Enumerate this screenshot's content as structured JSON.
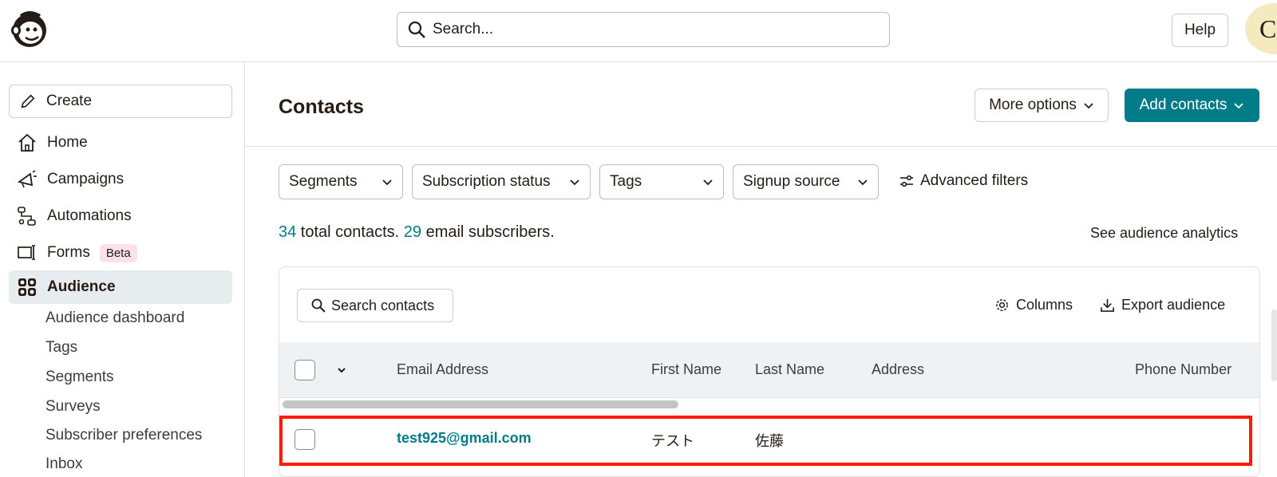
{
  "topbar": {
    "search_placeholder": "Search...",
    "help_label": "Help",
    "avatar_initial": "C"
  },
  "sidebar": {
    "create_label": "Create",
    "items": [
      {
        "label": "Home",
        "icon": "home-icon"
      },
      {
        "label": "Campaigns",
        "icon": "megaphone-icon"
      },
      {
        "label": "Automations",
        "icon": "automation-icon"
      },
      {
        "label": "Forms",
        "icon": "form-icon",
        "badge": "Beta"
      },
      {
        "label": "Audience",
        "icon": "audience-icon",
        "active": true
      }
    ],
    "sub_items": [
      "Audience dashboard",
      "Tags",
      "Segments",
      "Surveys",
      "Subscriber preferences",
      "Inbox"
    ]
  },
  "main": {
    "title": "Contacts",
    "more_options_label": "More options",
    "add_contacts_label": "Add contacts",
    "filters": [
      "Segments",
      "Subscription status",
      "Tags",
      "Signup source"
    ],
    "advanced_filters_label": "Advanced filters",
    "summary": {
      "total_contacts": "34",
      "total_text": " total contacts. ",
      "email_subscribers": "29",
      "subscribers_text": " email subscribers."
    },
    "analytics_link": "See audience analytics"
  },
  "table": {
    "search_label": "Search contacts",
    "columns_label": "Columns",
    "export_label": "Export audience",
    "headers": [
      "Email Address",
      "First Name",
      "Last Name",
      "Address",
      "Phone Number"
    ],
    "rows": [
      {
        "email": "test925@gmail.com",
        "first_name": "テスト",
        "last_name": "佐藤",
        "address": "",
        "phone": ""
      }
    ]
  },
  "colors": {
    "brand_teal": "#007c89",
    "highlight_red": "#ff1a00",
    "active_nav_bg": "#e7ecef"
  }
}
